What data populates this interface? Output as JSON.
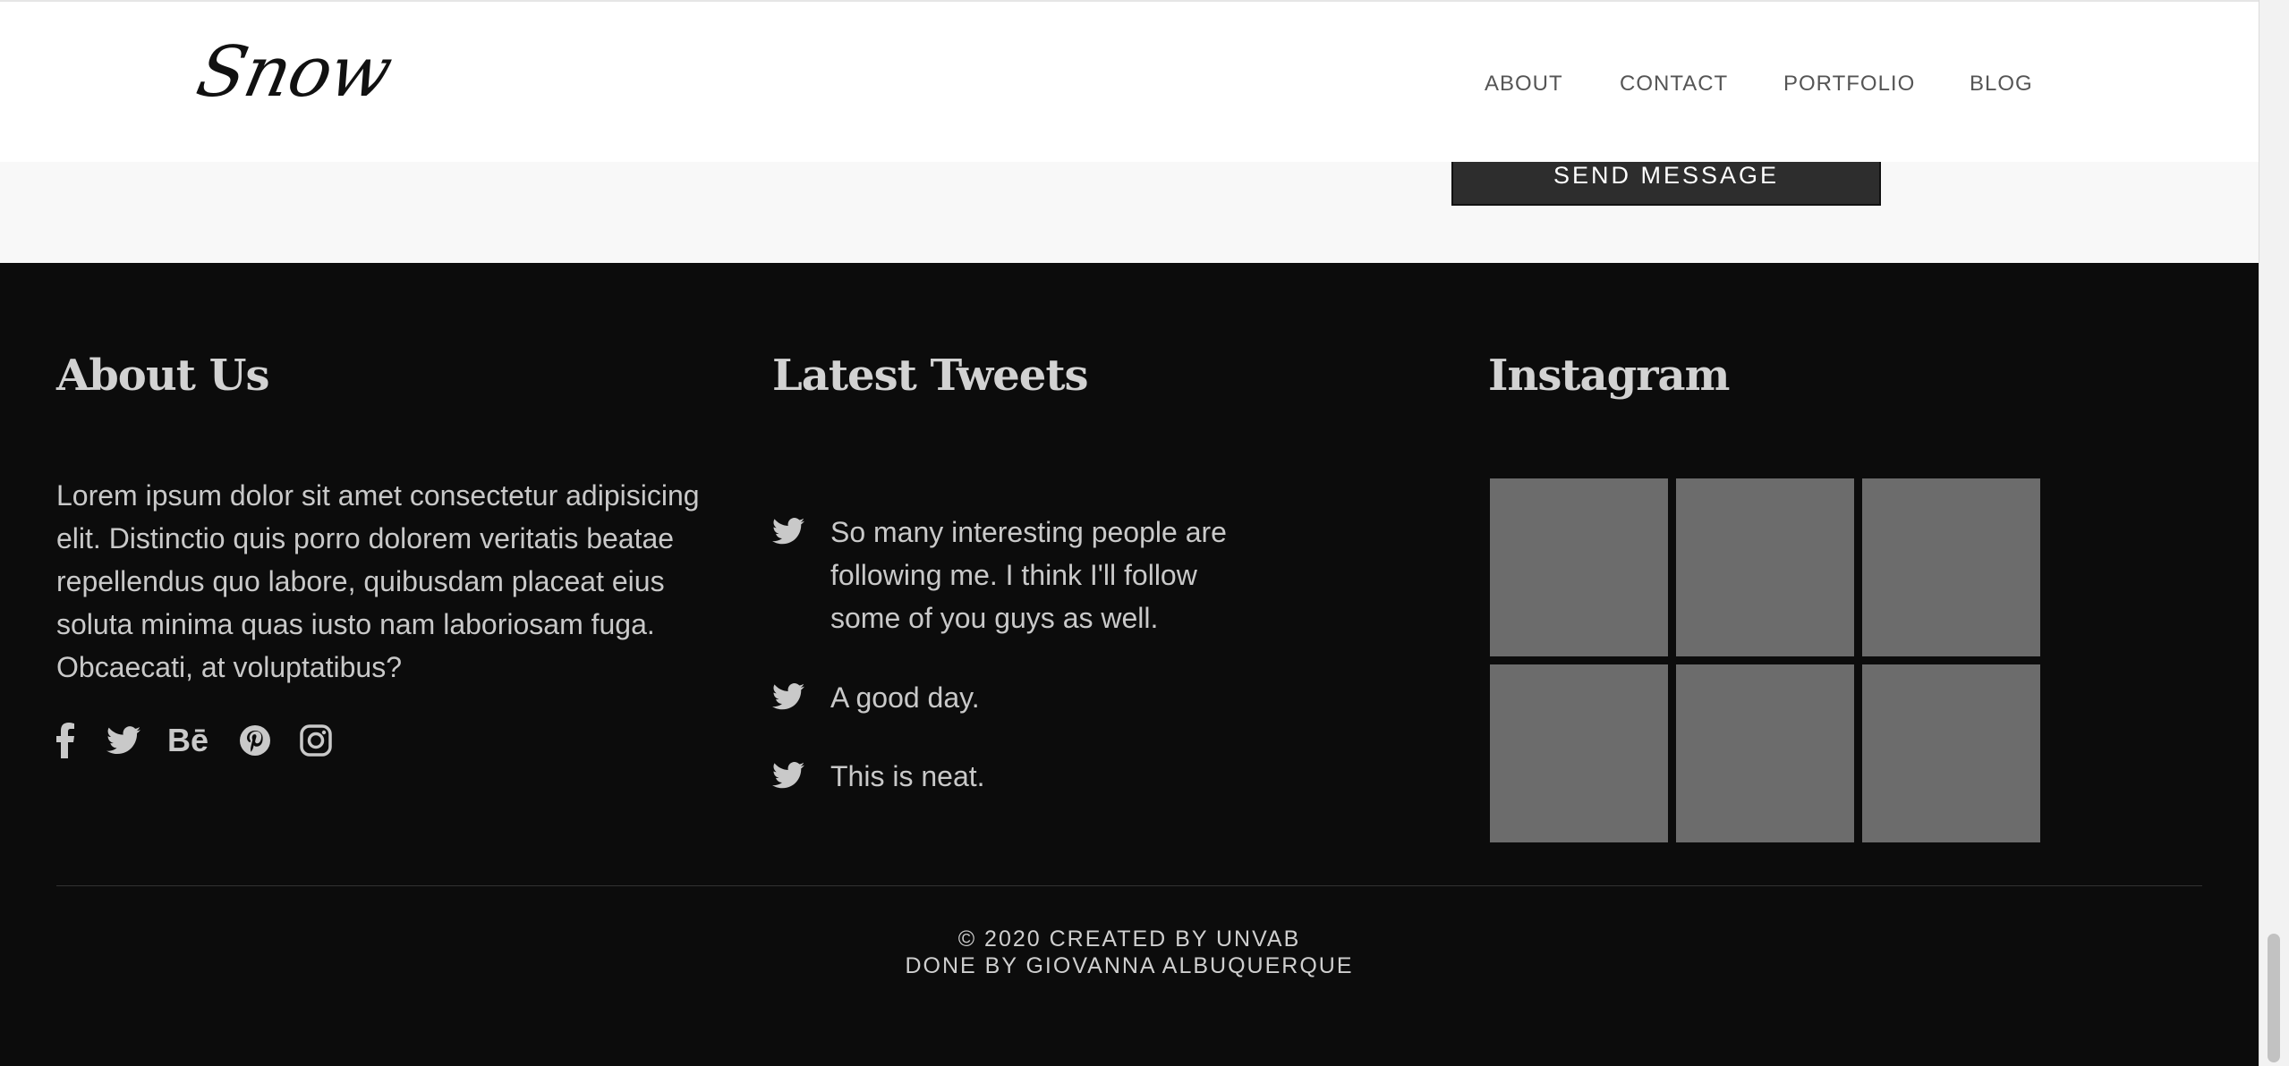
{
  "header": {
    "logo": "Snow",
    "nav": [
      "ABOUT",
      "CONTACT",
      "PORTFOLIO",
      "BLOG"
    ]
  },
  "contact": {
    "send_label": "SEND MESSAGE"
  },
  "footer": {
    "about": {
      "title": "About Us",
      "text": "Lorem ipsum dolor sit amet consectetur adipisicing elit. Distinctio quis porro dolorem veritatis beatae repellendus quo labore, quibusdam placeat eius soluta minima quas iusto nam laboriosam fuga. Obcaecati, at voluptatibus?",
      "social": [
        "facebook-icon",
        "twitter-icon",
        "behance-icon",
        "pinterest-icon",
        "instagram-icon"
      ]
    },
    "tweets": {
      "title": "Latest Tweets",
      "items": [
        "So many interesting people are following me. I think I'll follow some of you guys as well.",
        "A good day.",
        "This is neat."
      ]
    },
    "instagram": {
      "title": "Instagram"
    },
    "copyright": "© 2020 CREATED BY UNVAB",
    "credit": "DONE BY GIOVANNA ALBUQUERQUE"
  },
  "colors": {
    "footer_bg": "#0c0c0c",
    "text": "#c9c9c9",
    "placeholder": "#6c6c6c"
  }
}
